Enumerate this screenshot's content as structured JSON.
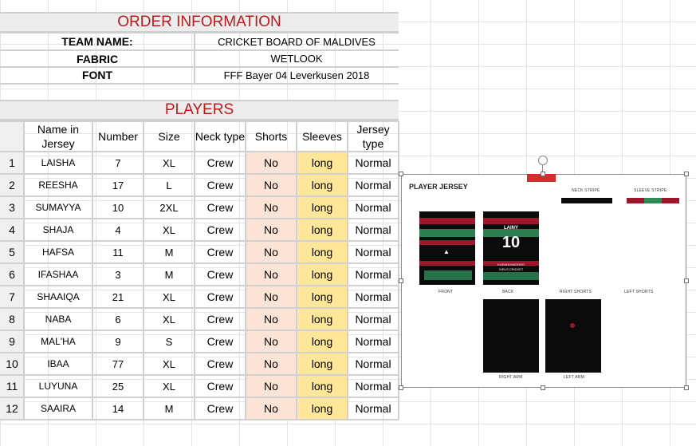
{
  "order": {
    "title": "ORDER INFORMATION",
    "team_label": "TEAM NAME:",
    "team_value": "CRICKET BOARD OF MALDIVES",
    "fabric_label": "FABRIC",
    "fabric_value": "WETLOOK",
    "font_label": "FONT",
    "font_value": "FFF Bayer 04 Leverkusen 2018"
  },
  "players": {
    "title": "PLAYERS",
    "headers": [
      "Name in Jersey",
      "Number",
      "Size",
      "Neck type",
      "Shorts",
      "Sleeves",
      "Jersey type"
    ],
    "rows": [
      {
        "n": "1",
        "name": "LAISHA",
        "number": "7",
        "size": "XL",
        "neck": "Crew",
        "shorts": "No",
        "sleeves": "long",
        "type": "Normal"
      },
      {
        "n": "2",
        "name": "REESHA",
        "number": "17",
        "size": "L",
        "neck": "Crew",
        "shorts": "No",
        "sleeves": "long",
        "type": "Normal"
      },
      {
        "n": "3",
        "name": "SUMAYYA",
        "number": "10",
        "size": "2XL",
        "neck": "Crew",
        "shorts": "No",
        "sleeves": "long",
        "type": "Normal"
      },
      {
        "n": "4",
        "name": "SHAJA",
        "number": "4",
        "size": "XL",
        "neck": "Crew",
        "shorts": "No",
        "sleeves": "long",
        "type": "Normal"
      },
      {
        "n": "5",
        "name": "HAFSA",
        "number": "11",
        "size": "M",
        "neck": "Crew",
        "shorts": "No",
        "sleeves": "long",
        "type": "Normal"
      },
      {
        "n": "6",
        "name": "IFASHAA",
        "number": "3",
        "size": "M",
        "neck": "Crew",
        "shorts": "No",
        "sleeves": "long",
        "type": "Normal"
      },
      {
        "n": "7",
        "name": "SHAAIQA",
        "number": "21",
        "size": "XL",
        "neck": "Crew",
        "shorts": "No",
        "sleeves": "long",
        "type": "Normal"
      },
      {
        "n": "8",
        "name": "NABA",
        "number": "6",
        "size": "XL",
        "neck": "Crew",
        "shorts": "No",
        "sleeves": "long",
        "type": "Normal"
      },
      {
        "n": "9",
        "name": "MAL'HA",
        "number": "9",
        "size": "S",
        "neck": "Crew",
        "shorts": "No",
        "sleeves": "long",
        "type": "Normal"
      },
      {
        "n": "10",
        "name": "IBAA",
        "number": "77",
        "size": "XL",
        "neck": "Crew",
        "shorts": "No",
        "sleeves": "long",
        "type": "Normal"
      },
      {
        "n": "11",
        "name": "LUYUNA",
        "number": "25",
        "size": "XL",
        "neck": "Crew",
        "shorts": "No",
        "sleeves": "long",
        "type": "Normal"
      },
      {
        "n": "12",
        "name": "SAAIRA",
        "number": "14",
        "size": "M",
        "neck": "Crew",
        "shorts": "No",
        "sleeves": "long",
        "type": "Normal"
      }
    ]
  },
  "jersey_image": {
    "title": "PLAYER JERSEY",
    "neck_stripe": "NECK STRIPE",
    "sleeve_stripe": "SLEEVE STRIPE",
    "front": "FRONT",
    "back": "BACK",
    "right_shorts": "RIGHT SHORTS",
    "left_shorts": "LEFT SHORTS",
    "right_arm": "RIGHT ARM",
    "left_arm": "LEFT ARM",
    "back_name": "LAINY",
    "back_number": "10",
    "back_sponsor_1": "KUDAHUVADHOO",
    "back_sponsor_2": "GIRLS CRICKET"
  },
  "colors": {
    "title_red": "#c0191c",
    "shorts_fill": "#fbe3d6",
    "sleeves_fill": "#ffe699",
    "jersey_black": "#0b0b0b",
    "stripe_red": "#a0172c",
    "stripe_green": "#2e8b57"
  }
}
